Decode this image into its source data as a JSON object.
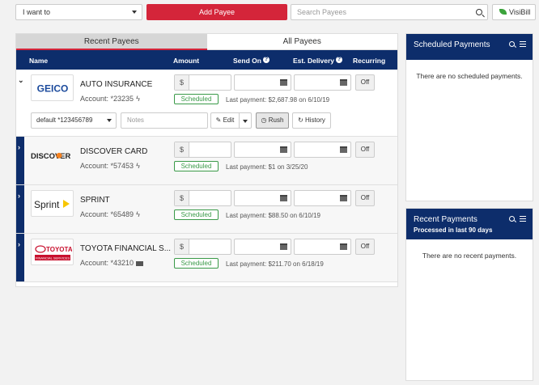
{
  "topbar": {
    "want_label": "I want to",
    "add_payee": "Add Payee",
    "search_placeholder": "Search Payees",
    "visibill": "VisiBill"
  },
  "tabs": [
    {
      "label": "Recent Payees",
      "active": true
    },
    {
      "label": "All Payees",
      "active": false
    }
  ],
  "columns": {
    "name": "Name",
    "amount": "Amount",
    "send_on": "Send On",
    "est_delivery": "Est. Delivery",
    "recurring": "Recurring"
  },
  "payees": [
    {
      "logo": "GEICO",
      "name": "AUTO INSURANCE",
      "account": "Account: *23235",
      "delivery_icon": "bolt-icon",
      "amount_prefix": "$",
      "recurring": "Off",
      "status": "Scheduled",
      "last_payment": "Last payment: $2,687.98 on 6/10/19",
      "expanded": true,
      "funding_account": "default *123456789",
      "notes_placeholder": "Notes",
      "edit": "Edit",
      "rush": "Rush",
      "history": "History"
    },
    {
      "logo": "DISCOVER",
      "name": "DISCOVER CARD",
      "account": "Account: *57453",
      "delivery_icon": "bolt-icon",
      "amount_prefix": "$",
      "recurring": "Off",
      "status": "Scheduled",
      "last_payment": "Last payment: $1 on 3/25/20"
    },
    {
      "logo": "Sprint",
      "name": "SPRINT",
      "account": "Account: *65489",
      "delivery_icon": "bolt-icon",
      "amount_prefix": "$",
      "recurring": "Off",
      "status": "Scheduled",
      "last_payment": "Last payment: $88.50 on 6/10/19"
    },
    {
      "logo": "TOYOTA",
      "logo_sub": "FINANCIAL SERVICES",
      "name": "TOYOTA FINANCIAL S...",
      "account": "Account: *43210",
      "delivery_icon": "mail-icon",
      "amount_prefix": "$",
      "recurring": "Off",
      "status": "Scheduled",
      "last_payment": "Last payment: $211.70 on 6/18/19"
    }
  ],
  "scheduled_panel": {
    "title": "Scheduled Payments",
    "empty": "There are no scheduled payments."
  },
  "recent_panel": {
    "title": "Recent Payments",
    "subtitle": "Processed in last 90 days",
    "empty": "There are no recent payments."
  },
  "colors": {
    "navy": "#0d2d6b",
    "red": "#d4253a",
    "green": "#3a9a48"
  }
}
